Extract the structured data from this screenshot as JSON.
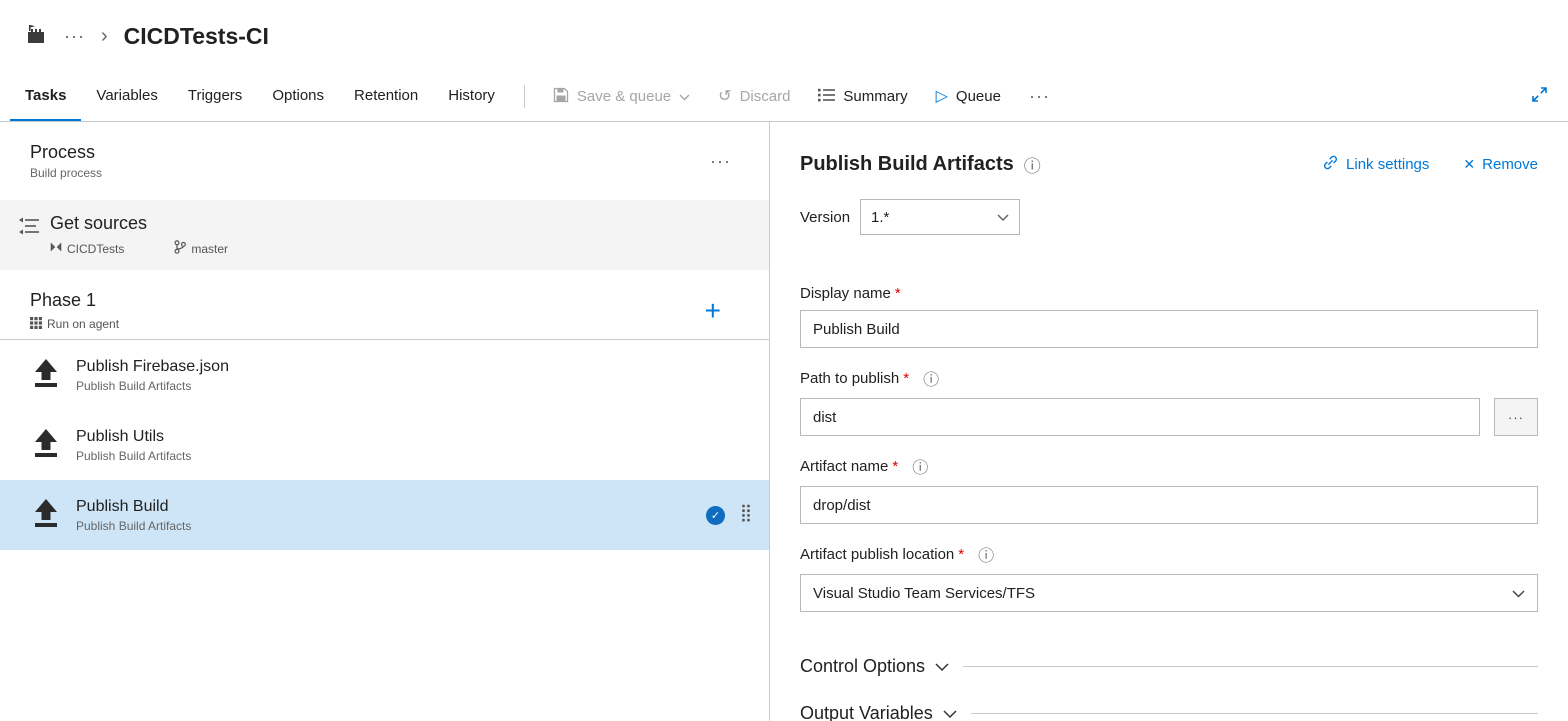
{
  "required_mark": "*",
  "colors": {
    "accent": "#0078d7",
    "selected_task_bg": "#cde5f7",
    "disabled_text": "#a6a6a6",
    "required": "#dd0000"
  },
  "icons": {
    "breadcrumb_more": "···",
    "breadcrumb_chevron": "›",
    "toolbar_more": "···",
    "process_more": "···",
    "add": "+",
    "info": "ⓘ",
    "remove_x": "✕",
    "queue_play": "▷",
    "discard_undo": "↺",
    "check": "✓",
    "browse": "···"
  },
  "header": {
    "title": "CICDTests-CI"
  },
  "tabs": [
    {
      "label": "Tasks",
      "active": true
    },
    {
      "label": "Variables",
      "active": false
    },
    {
      "label": "Triggers",
      "active": false
    },
    {
      "label": "Options",
      "active": false
    },
    {
      "label": "Retention",
      "active": false
    },
    {
      "label": "History",
      "active": false
    }
  ],
  "toolbar": {
    "save_queue": "Save & queue",
    "discard": "Discard",
    "summary": "Summary",
    "queue": "Queue"
  },
  "process": {
    "title": "Process",
    "subtitle": "Build process",
    "get_sources": {
      "title": "Get sources",
      "repo": "CICDTests",
      "branch": "master"
    },
    "phase": {
      "title": "Phase 1",
      "subtitle": "Run on agent"
    },
    "tasks": [
      {
        "name": "Publish Firebase.json",
        "type": "Publish Build Artifacts",
        "selected": false
      },
      {
        "name": "Publish Utils",
        "type": "Publish Build Artifacts",
        "selected": false
      },
      {
        "name": "Publish Build",
        "type": "Publish Build Artifacts",
        "selected": true
      }
    ]
  },
  "details": {
    "title": "Publish Build Artifacts",
    "link_settings": "Link settings",
    "remove": "Remove",
    "version": {
      "label": "Version",
      "value": "1.*"
    },
    "fields": {
      "display_name": {
        "label": "Display name",
        "value": "Publish Build"
      },
      "path_to_publish": {
        "label": "Path to publish",
        "value": "dist"
      },
      "artifact_name": {
        "label": "Artifact name",
        "value": "drop/dist"
      },
      "artifact_publish_location": {
        "label": "Artifact publish location",
        "value": "Visual Studio Team Services/TFS"
      }
    },
    "sections": {
      "control_options": "Control Options",
      "output_variables": "Output Variables"
    }
  }
}
